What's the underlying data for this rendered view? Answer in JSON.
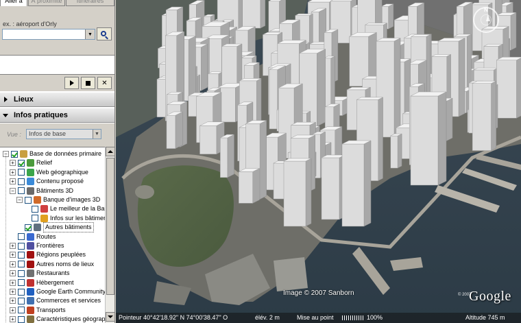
{
  "search": {
    "tabs": [
      "Aller à",
      "À proximité",
      "Itinéraires"
    ],
    "hint": "ex. : aéroport d'Orly",
    "query_value": ""
  },
  "panels": {
    "lieux": "Lieux",
    "infos": "Infos pratiques"
  },
  "view": {
    "label": "Vue :",
    "selected": "Infos de base"
  },
  "layers": [
    {
      "label": "Base de données primaire",
      "expander": "-",
      "checked": true,
      "icon": "globe-icon",
      "color": "#c8a040"
    },
    {
      "label": "Relief",
      "expander": "+",
      "checked": true,
      "icon": "terrain-icon",
      "color": "#4b9a3c"
    },
    {
      "label": "Web géographique",
      "expander": "+",
      "checked": false,
      "icon": "star-icon",
      "color": "#3aa54a"
    },
    {
      "label": "Contenu proposé",
      "expander": "+",
      "checked": false,
      "icon": "star-icon",
      "color": "#3a8ad8"
    },
    {
      "label": "Bâtiments 3D",
      "expander": "-",
      "checked": false,
      "icon": "building-icon",
      "color": "#6a6a6a"
    },
    {
      "label": "Banque d'images 3D",
      "expander": "-",
      "checked": false,
      "icon": "image-bank-icon",
      "color": "#d06a2a"
    },
    {
      "label": "Le meilleur de la Banque",
      "expander": "",
      "checked": false,
      "icon": "best-icon",
      "color": "#d04040"
    },
    {
      "label": "Infos sur les bâtiments",
      "expander": "",
      "checked": false,
      "icon": "info-icon",
      "color": "#e0a020"
    },
    {
      "label": "Autres bâtiments",
      "expander": "",
      "checked": true,
      "icon": "building-icon",
      "color": "#607080",
      "selected": true
    },
    {
      "label": "Routes",
      "expander": "",
      "checked": false,
      "icon": "road-icon",
      "color": "#3a6ad0"
    },
    {
      "label": "Frontières",
      "expander": "+",
      "checked": false,
      "icon": "border-icon",
      "color": "#5050a0"
    },
    {
      "label": "Régions peuplées",
      "expander": "+",
      "checked": false,
      "icon": "dot-icon",
      "color": "#a01010"
    },
    {
      "label": "Autres noms de lieux",
      "expander": "+",
      "checked": false,
      "icon": "dot-icon",
      "color": "#a01010"
    },
    {
      "label": "Restaurants",
      "expander": "+",
      "checked": false,
      "icon": "fork-icon",
      "color": "#707070"
    },
    {
      "label": "Hébergement",
      "expander": "+",
      "checked": false,
      "icon": "lodging-icon",
      "color": "#c03030"
    },
    {
      "label": "Google Earth Community",
      "expander": "+",
      "checked": false,
      "icon": "info-icon",
      "color": "#2060c0"
    },
    {
      "label": "Commerces et services",
      "expander": "+",
      "checked": false,
      "icon": "shop-icon",
      "color": "#4070b0"
    },
    {
      "label": "Transports",
      "expander": "+",
      "checked": false,
      "icon": "transit-icon",
      "color": "#c04020"
    },
    {
      "label": "Caractéristiques géographiques",
      "expander": "+",
      "checked": false,
      "icon": "geo-icon",
      "color": "#807040"
    }
  ],
  "map": {
    "copyright": "Image © 2007 Sanborn",
    "logo": "Google",
    "logo_sup": "© 2007"
  },
  "status": {
    "pointer": "Pointeur  40°42'18.92\" N    74°00'38.47\" O",
    "elev": "élév.    2 m",
    "stream": "Mise au point",
    "percent": "100%",
    "alt": "Altitude    745 m"
  }
}
